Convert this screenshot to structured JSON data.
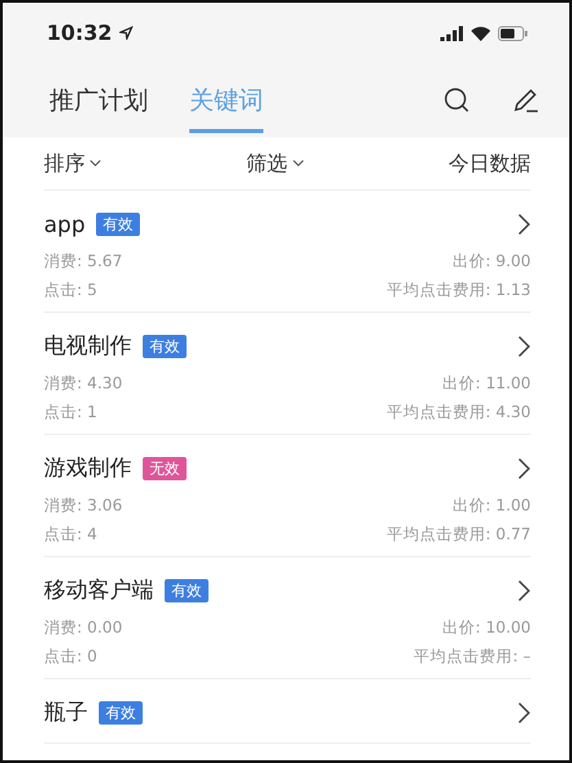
{
  "status_bar": {
    "time": "10:32"
  },
  "tabs": [
    {
      "label": "推广计划",
      "selected": false
    },
    {
      "label": "关键词",
      "selected": true
    }
  ],
  "filter_bar": {
    "sort": "排序",
    "filter": "筛选",
    "data_range": "今日数据"
  },
  "keywords": [
    {
      "name": "app",
      "tag": {
        "label": "有效",
        "color": "#3d7fe0"
      },
      "cost": "消费: 5.67",
      "bid": "出价: 9.00",
      "clicks": "点击: 5",
      "avg_cost": "平均点击费用: 1.13"
    },
    {
      "name": "电视制作",
      "tag": {
        "label": "有效",
        "color": "#3d7fe0"
      },
      "cost": "消费: 4.30",
      "bid": "出价: 11.00",
      "clicks": "点击: 1",
      "avg_cost": "平均点击费用: 4.30"
    },
    {
      "name": "游戏制作",
      "tag": {
        "label": "无效",
        "color": "#e0559a"
      },
      "cost": "消费: 3.06",
      "bid": "出价: 1.00",
      "clicks": "点击: 4",
      "avg_cost": "平均点击费用: 0.77"
    },
    {
      "name": "移动客户端",
      "tag": {
        "label": "有效",
        "color": "#3d7fe0"
      },
      "cost": "消费: 0.00",
      "bid": "出价: 10.00",
      "clicks": "点击: 0",
      "avg_cost": "平均点击费用: –"
    },
    {
      "name": "瓶子",
      "tag": {
        "label": "有效",
        "color": "#3d7fe0"
      }
    }
  ]
}
